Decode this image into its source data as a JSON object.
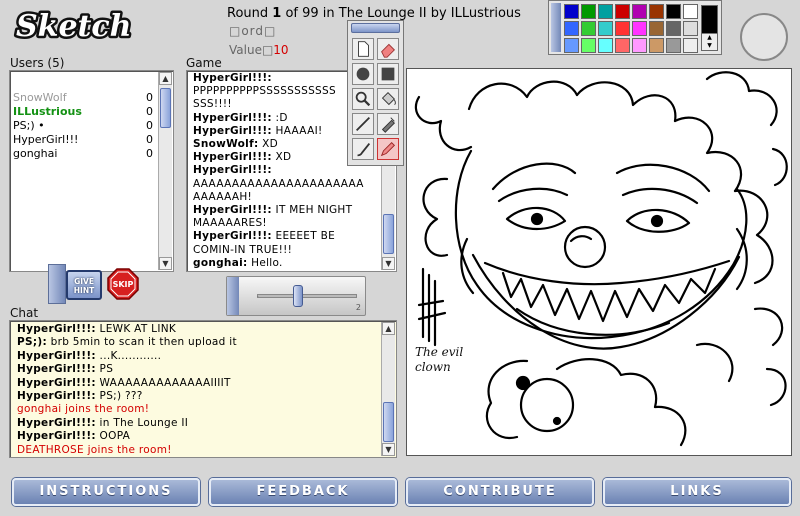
{
  "logo": {
    "text": "Sketch"
  },
  "header": {
    "round_prefix": "Round",
    "round_num": "1",
    "round_mid": "of 99 in The Lounge II by ILLustrious",
    "word_label": "□ord□",
    "value_label": "Value□",
    "value_num": "10"
  },
  "users": {
    "title": "Users (5)",
    "list": [
      {
        "name": "SnowWolf",
        "score": "0",
        "color": "#9a9a9a",
        "bold": false
      },
      {
        "name": "ILLustrious",
        "score": "0",
        "color": "#139113",
        "bold": true
      },
      {
        "name": "PS;) •",
        "score": "0",
        "color": "#000000",
        "bold": false
      },
      {
        "name": "HyperGirl!!!",
        "score": "0",
        "color": "#000000",
        "bold": false
      },
      {
        "name": "gonghai",
        "score": "0",
        "color": "#000000",
        "bold": false
      }
    ]
  },
  "game": {
    "title": "Game",
    "lines": [
      {
        "who": "HyperGirl!!!:",
        "msg": ""
      },
      {
        "who": "",
        "msg": "PPPPPPPPPPSSSSSSSSSSS"
      },
      {
        "who": "",
        "msg": "SSS!!!!"
      },
      {
        "who": "HyperGirl!!!:",
        "msg": " :D"
      },
      {
        "who": "HyperGirl!!!:",
        "msg": " HAAAAI!"
      },
      {
        "who": "SnowWolf:",
        "msg": " XD"
      },
      {
        "who": "HyperGirl!!!:",
        "msg": " XD"
      },
      {
        "who": "HyperGirl!!!:",
        "msg": ""
      },
      {
        "who": "",
        "msg": "AAAAAAAAAAAAAAAAAAAAAA"
      },
      {
        "who": "",
        "msg": "AAAAAAH!"
      },
      {
        "who": "HyperGirl!!!:",
        "msg": " IT MEH NIGHT"
      },
      {
        "who": "",
        "msg": "MAAAAARES!"
      },
      {
        "who": "HyperGirl!!!:",
        "msg": " EEEEET BE"
      },
      {
        "who": "",
        "msg": "COMIN-IN TRUE!!!"
      },
      {
        "who": "gonghai:",
        "msg": " Hello."
      }
    ]
  },
  "chat": {
    "title": "Chat",
    "lines": [
      {
        "who": "HyperGirl!!!:",
        "msg": " LEWK AT LINK",
        "sys": false
      },
      {
        "who": "PS;):",
        "msg": " brb 5min to scan it then upload it",
        "sys": false
      },
      {
        "who": "HyperGirl!!!:",
        "msg": " ...K............",
        "sys": false
      },
      {
        "who": "HyperGirl!!!:",
        "msg": " PS",
        "sys": false
      },
      {
        "who": "HyperGirl!!!:",
        "msg": " WAAAAAAAAAAAAAIIIIT",
        "sys": false
      },
      {
        "who": "HyperGirl!!!:",
        "msg": " PS;) ???",
        "sys": false
      },
      {
        "who": "",
        "msg": "gonghai joins the room!",
        "sys": true
      },
      {
        "who": "HyperGirl!!!:",
        "msg": " in The Lounge II",
        "sys": false
      },
      {
        "who": "HyperGirl!!!:",
        "msg": " OOPA",
        "sys": false
      },
      {
        "who": "",
        "msg": "DEATHROSE joins the room!",
        "sys": true
      }
    ]
  },
  "buttons": {
    "hint": "GIVE HINT",
    "skip": "SKIP"
  },
  "slider": {
    "max_label": "2",
    "level": 0.4
  },
  "tools": [
    "page-icon",
    "eraser-icon",
    "filled-circle-icon",
    "filled-square-icon",
    "magnifier-icon",
    "paint-bucket-icon",
    "line-icon",
    "fill-pen-icon",
    "brush-icon",
    "pencil-icon"
  ],
  "palette": {
    "colors": [
      "#0000cc",
      "#009900",
      "#00a0a0",
      "#cc0000",
      "#b000b0",
      "#993300",
      "#000000",
      "#ffffff",
      "#3366ff",
      "#33cc33",
      "#33cccc",
      "#ff3333",
      "#ff33ff",
      "#996633",
      "#666666",
      "#dddddd",
      "#6699ff",
      "#66ff66",
      "#66ffff",
      "#ff6666",
      "#ff99ff",
      "#cc9966",
      "#999999",
      "#eeeeee"
    ],
    "current": "#000000"
  },
  "drawing": {
    "caption_line1": "The evil",
    "caption_line2": "clown"
  },
  "nav": {
    "instructions": "INSTRUCTIONS",
    "feedback": "FEEDBACK",
    "contribute": "CONTRIBUTE",
    "links": "LINKS"
  }
}
